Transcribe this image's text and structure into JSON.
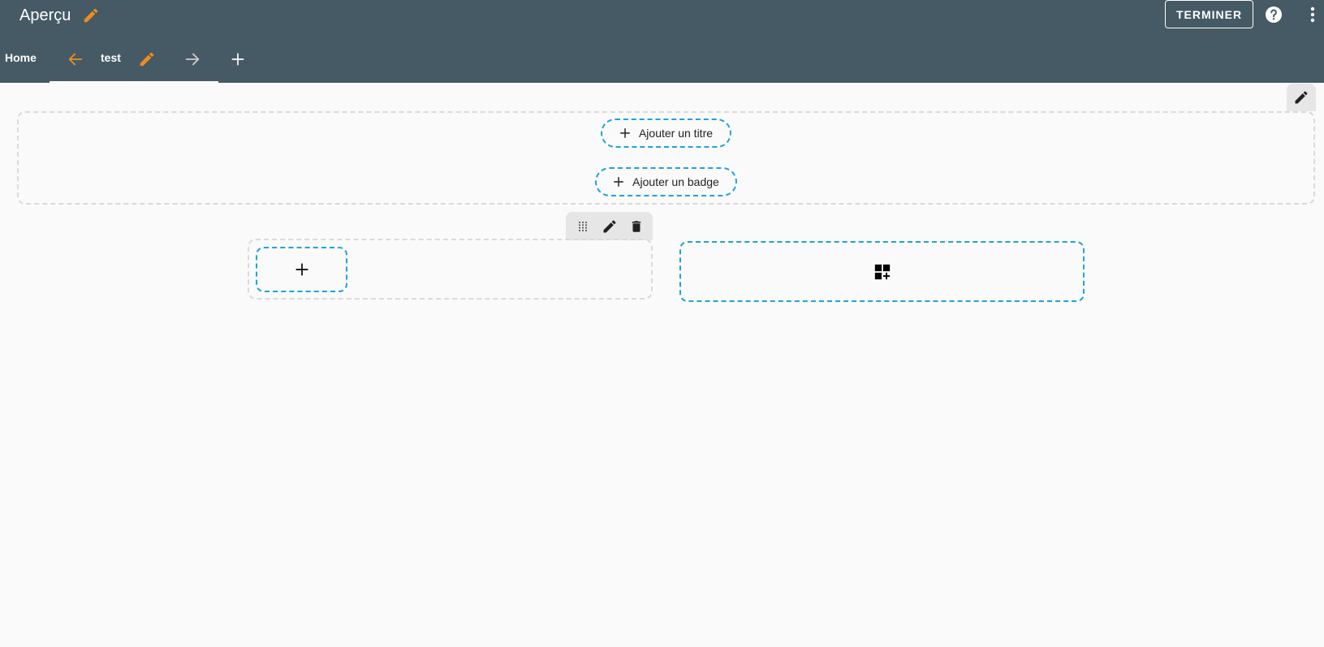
{
  "header": {
    "title": "Aperçu",
    "finish_label": "TERMINER",
    "icons": {
      "title_edit": "pencil-icon",
      "help": "help-circle-icon",
      "more": "more-vert-icon"
    }
  },
  "tabs": {
    "home_label": "Home",
    "active": {
      "label": "test",
      "prev_icon": "arrow-left-icon",
      "edit_icon": "pencil-icon",
      "next_icon": "arrow-right-icon"
    },
    "add_icon": "plus-icon"
  },
  "editor": {
    "section_edit_icon": "pencil-icon",
    "add_title_label": "Ajouter un titre",
    "add_badge_label": "Ajouter un badge",
    "row_toolbar": {
      "drag_icon": "drag-handle-icon",
      "edit_icon": "pencil-icon",
      "delete_icon": "trash-icon"
    },
    "add_item_icon": "plus-icon",
    "add_widget_icon": "widgets-add-icon"
  },
  "colors": {
    "appbar": "#455a64",
    "accent": "#ef8c1e",
    "dashed_border": "#1ea2de",
    "background": "#fafafa"
  }
}
